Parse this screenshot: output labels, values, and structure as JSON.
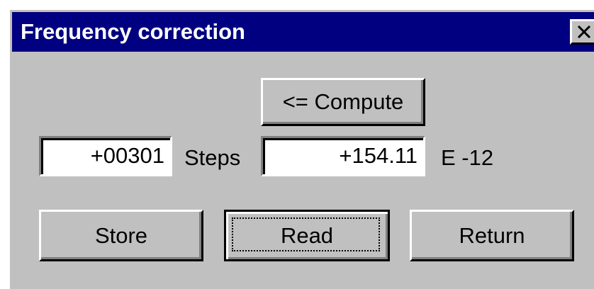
{
  "window": {
    "title": "Frequency correction",
    "close_icon": "close-icon"
  },
  "compute_button": {
    "label": "<= Compute"
  },
  "steps": {
    "value": "+00301",
    "unit_label": "Steps"
  },
  "correction": {
    "value": "+154.11",
    "unit_label": "E -12"
  },
  "buttons": {
    "store": "Store",
    "read": "Read",
    "return": "Return"
  },
  "colors": {
    "titlebar": "#000080",
    "face": "#c0c0c0"
  }
}
